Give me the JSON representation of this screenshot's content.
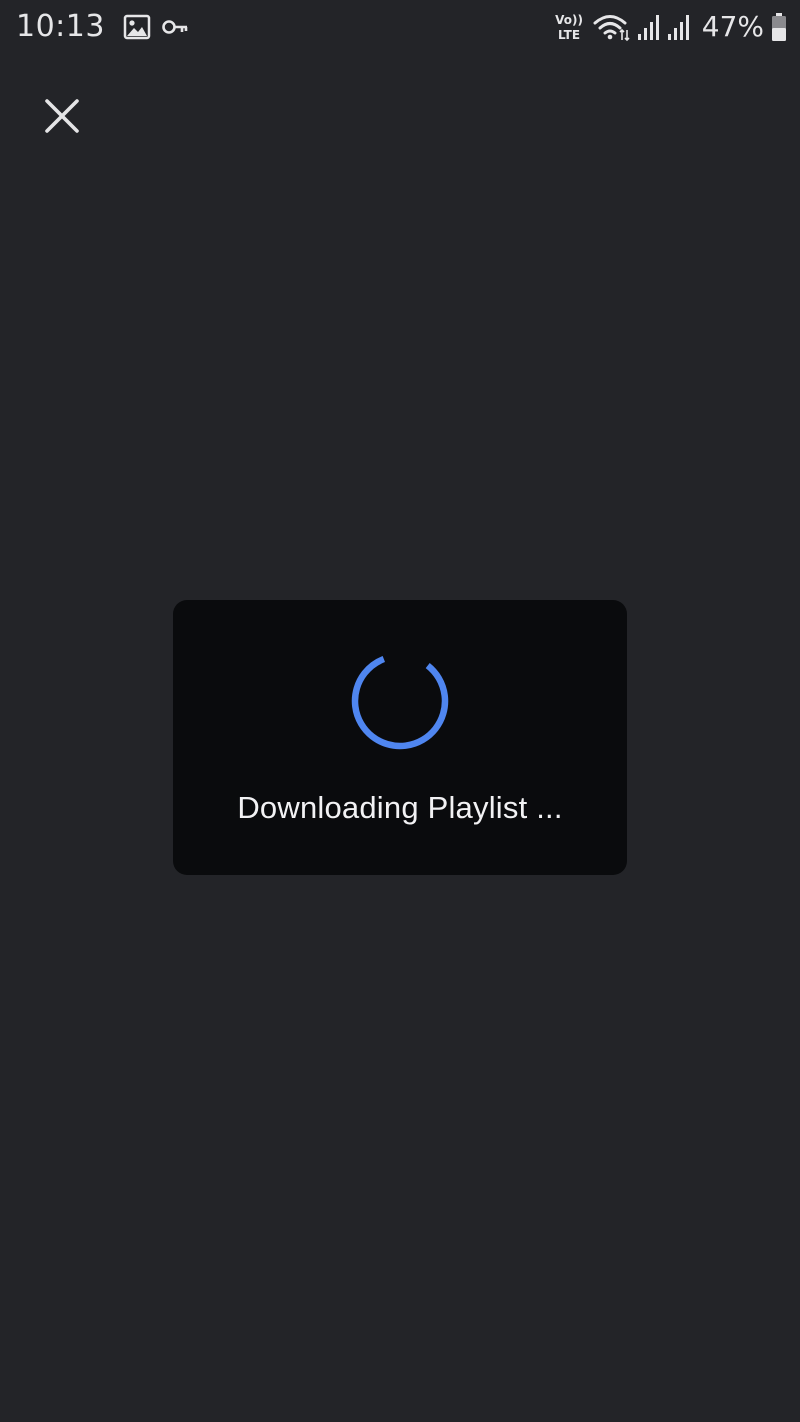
{
  "status_bar": {
    "time": "10:13",
    "volte_label_top": "Vo))",
    "volte_label_bottom": "LTE",
    "battery_percent": "47%",
    "icons": [
      "gallery-icon",
      "key-icon",
      "volte-icon",
      "wifi-icon",
      "signal-icon",
      "signal-icon",
      "battery-icon"
    ]
  },
  "toolbar": {
    "close_icon": "close-icon"
  },
  "dialog": {
    "message": "Downloading Playlist ...",
    "spinner_icon": "spinner-icon"
  },
  "colors": {
    "background": "#232428",
    "dialog_background": "#0a0b0d",
    "accent": "#4f86f0",
    "text": "#f2f2f4"
  }
}
